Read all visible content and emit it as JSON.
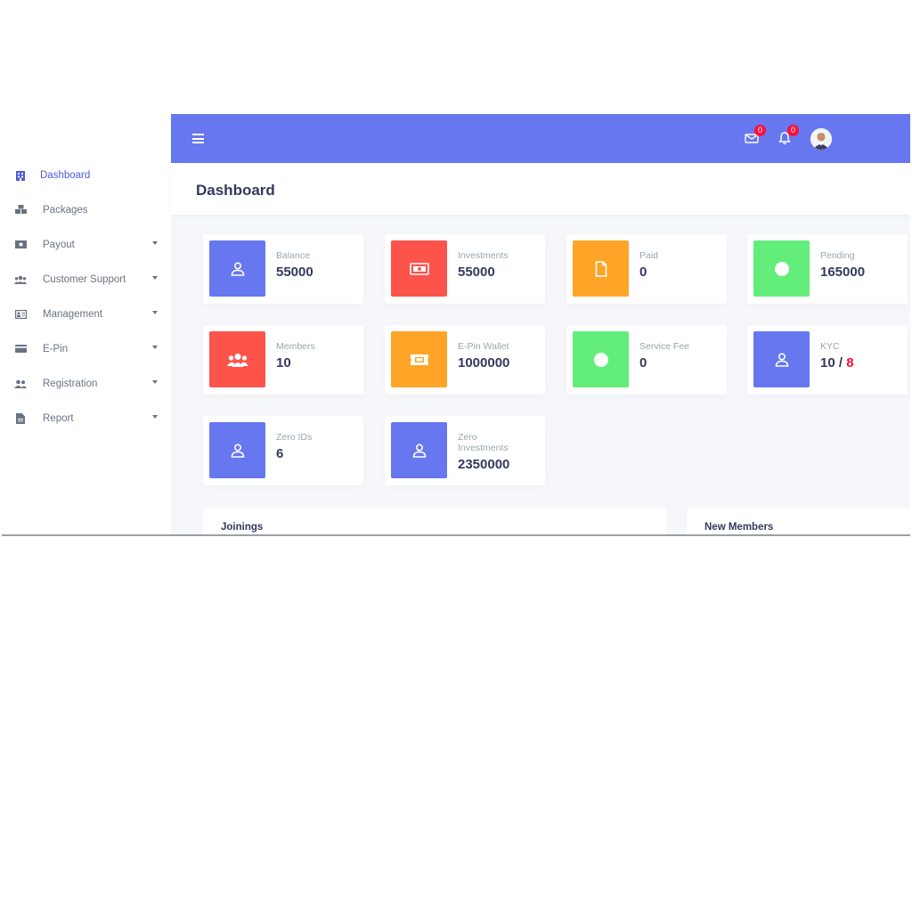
{
  "colors": {
    "primary": "#6777ef",
    "danger": "#fc544b",
    "warning": "#ffa426",
    "success": "#63ed7a",
    "badge": "#fc0f3b",
    "active_nav": "#4f5bd5"
  },
  "sidebar": {
    "items": [
      {
        "label": "Dashboard",
        "icon": "building-icon",
        "active": true,
        "has_caret": false
      },
      {
        "label": "Packages",
        "icon": "boxes-icon",
        "has_caret": false
      },
      {
        "label": "Payout",
        "icon": "money-bill-icon",
        "has_caret": true
      },
      {
        "label": "Customer Support",
        "icon": "users-icon",
        "has_caret": true
      },
      {
        "label": "Management",
        "icon": "id-card-icon",
        "has_caret": true
      },
      {
        "label": "E-Pin",
        "icon": "credit-card-icon",
        "has_caret": true
      },
      {
        "label": "Registration",
        "icon": "user-friends-icon",
        "has_caret": true
      },
      {
        "label": "Report",
        "icon": "file-icon",
        "has_caret": true
      }
    ]
  },
  "topbar": {
    "messages_count": "0",
    "notifications_count": "0"
  },
  "page": {
    "title": "Dashboard"
  },
  "cards": [
    {
      "label": "Balance",
      "value": "55000",
      "icon": "user-icon",
      "color": "primary"
    },
    {
      "label": "Investments",
      "value": "55000",
      "icon": "money-icon",
      "color": "danger"
    },
    {
      "label": "Paid",
      "value": "0",
      "icon": "file-icon",
      "color": "warning"
    },
    {
      "label": "Pending",
      "value": "165000",
      "icon": "circle-icon",
      "color": "success"
    },
    {
      "label": "Members",
      "value": "10",
      "icon": "users-icon",
      "color": "danger"
    },
    {
      "label": "E-Pin Wallet",
      "value": "1000000",
      "icon": "ticket-icon",
      "color": "warning"
    },
    {
      "label": "Service Fee",
      "value": "0",
      "icon": "circle-icon",
      "color": "success"
    },
    {
      "label": "KYC",
      "value_a": "10",
      "value_sep": " / ",
      "value_b": "8",
      "icon": "user-icon",
      "color": "primary"
    },
    {
      "label": "Zero IDs",
      "value": "6",
      "icon": "user-icon",
      "color": "primary"
    },
    {
      "label": "Zero Investments",
      "value": "2350000",
      "icon": "user-icon",
      "color": "primary"
    }
  ],
  "sections": {
    "joinings_title": "Joinings",
    "new_members_title": "New Members"
  }
}
